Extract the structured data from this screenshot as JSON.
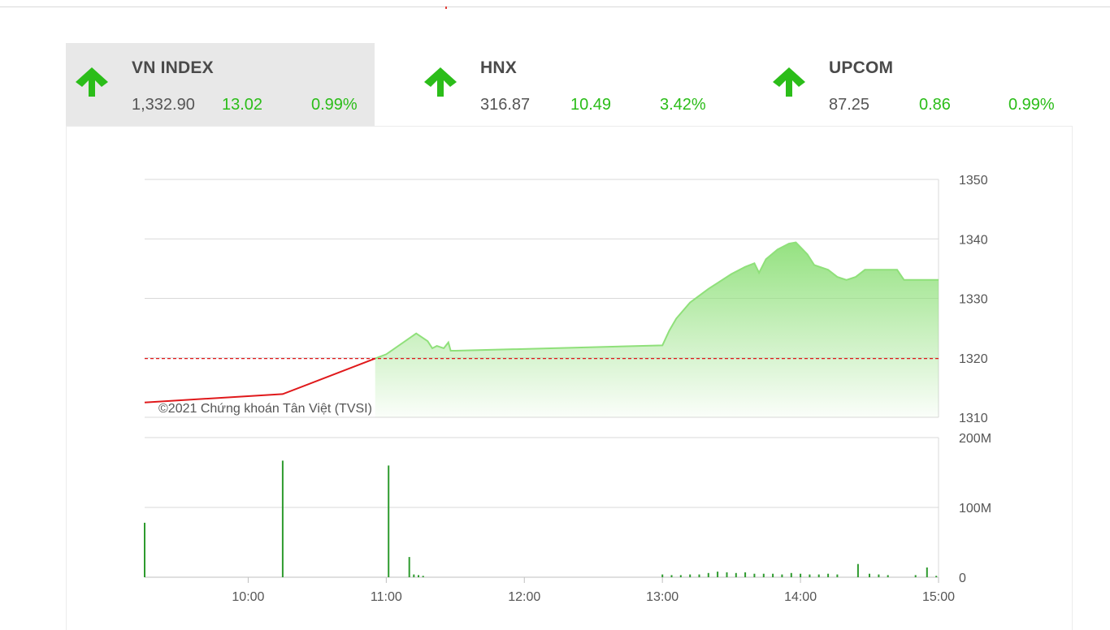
{
  "indices": [
    {
      "name": "VN INDEX",
      "price": "1,332.90",
      "change": "13.02",
      "percent": "0.99%",
      "active": true
    },
    {
      "name": "HNX",
      "price": "316.87",
      "change": "10.49",
      "percent": "3.42%",
      "active": false
    },
    {
      "name": "UPCOM",
      "price": "87.25",
      "change": "0.86",
      "percent": "0.99%",
      "active": false
    }
  ],
  "colors": {
    "up": "#2bbd19",
    "line": "#8fe07a",
    "below_ref": "#e0191b",
    "ref": "#e0191b",
    "volume": "#2e9b2e",
    "grid": "#d9d9d9"
  },
  "credit": "©2021 Chứng khoán Tân Việt (TVSI)",
  "chart_data": {
    "type": "area",
    "x_ticks": [
      "10:00",
      "11:00",
      "12:00",
      "13:00",
      "14:00",
      "15:00"
    ],
    "price": {
      "ylim": [
        1310,
        1350
      ],
      "y_ticks": [
        "1350",
        "1340",
        "1330",
        "1320",
        "1310"
      ],
      "reference": 1319.88,
      "points": [
        [
          "09:15",
          1312.5
        ],
        [
          "10:15",
          1313.9
        ],
        [
          "11:00",
          1320.6
        ],
        [
          "11:13",
          1324.1
        ],
        [
          "11:18",
          1322.8
        ],
        [
          "11:20",
          1321.6
        ],
        [
          "11:22",
          1322.0
        ],
        [
          "11:25",
          1321.6
        ],
        [
          "11:27",
          1322.6
        ],
        [
          "11:28",
          1321.2
        ],
        [
          "11:30",
          1321.2
        ],
        [
          "13:00",
          1322.1
        ],
        [
          "13:03",
          1324.6
        ],
        [
          "13:06",
          1326.6
        ],
        [
          "13:12",
          1329.3
        ],
        [
          "13:20",
          1331.6
        ],
        [
          "13:30",
          1334.1
        ],
        [
          "13:36",
          1335.3
        ],
        [
          "13:40",
          1335.9
        ],
        [
          "13:42",
          1334.3
        ],
        [
          "13:45",
          1336.6
        ],
        [
          "13:50",
          1338.2
        ],
        [
          "13:55",
          1339.2
        ],
        [
          "13:58",
          1339.4
        ],
        [
          "14:00",
          1338.6
        ],
        [
          "14:03",
          1337.4
        ],
        [
          "14:06",
          1335.6
        ],
        [
          "14:12",
          1334.8
        ],
        [
          "14:16",
          1333.6
        ],
        [
          "14:20",
          1333.1
        ],
        [
          "14:24",
          1333.6
        ],
        [
          "14:28",
          1334.8
        ],
        [
          "14:42",
          1334.8
        ],
        [
          "14:45",
          1333.1
        ],
        [
          "15:00",
          1333.1
        ]
      ]
    },
    "volume": {
      "ylim": [
        0,
        200
      ],
      "y_ticks": [
        "200M",
        "100M",
        "0"
      ],
      "points": [
        [
          "09:15",
          78
        ],
        [
          "10:15",
          167
        ],
        [
          "11:01",
          160
        ],
        [
          "11:10",
          29
        ],
        [
          "11:12",
          4
        ],
        [
          "11:14",
          3
        ],
        [
          "11:16",
          2
        ],
        [
          "13:00",
          4
        ],
        [
          "13:04",
          3
        ],
        [
          "13:08",
          3
        ],
        [
          "13:12",
          4
        ],
        [
          "13:16",
          4
        ],
        [
          "13:20",
          6
        ],
        [
          "13:24",
          8
        ],
        [
          "13:28",
          7
        ],
        [
          "13:32",
          6
        ],
        [
          "13:36",
          7
        ],
        [
          "13:40",
          5
        ],
        [
          "13:44",
          5
        ],
        [
          "13:48",
          5
        ],
        [
          "13:52",
          4
        ],
        [
          "13:56",
          6
        ],
        [
          "14:00",
          5
        ],
        [
          "14:04",
          4
        ],
        [
          "14:08",
          4
        ],
        [
          "14:12",
          5
        ],
        [
          "14:16",
          4
        ],
        [
          "14:25",
          19
        ],
        [
          "14:30",
          5
        ],
        [
          "14:34",
          4
        ],
        [
          "14:38",
          3
        ],
        [
          "14:50",
          3
        ],
        [
          "14:55",
          14
        ],
        [
          "14:59",
          2
        ]
      ]
    }
  }
}
